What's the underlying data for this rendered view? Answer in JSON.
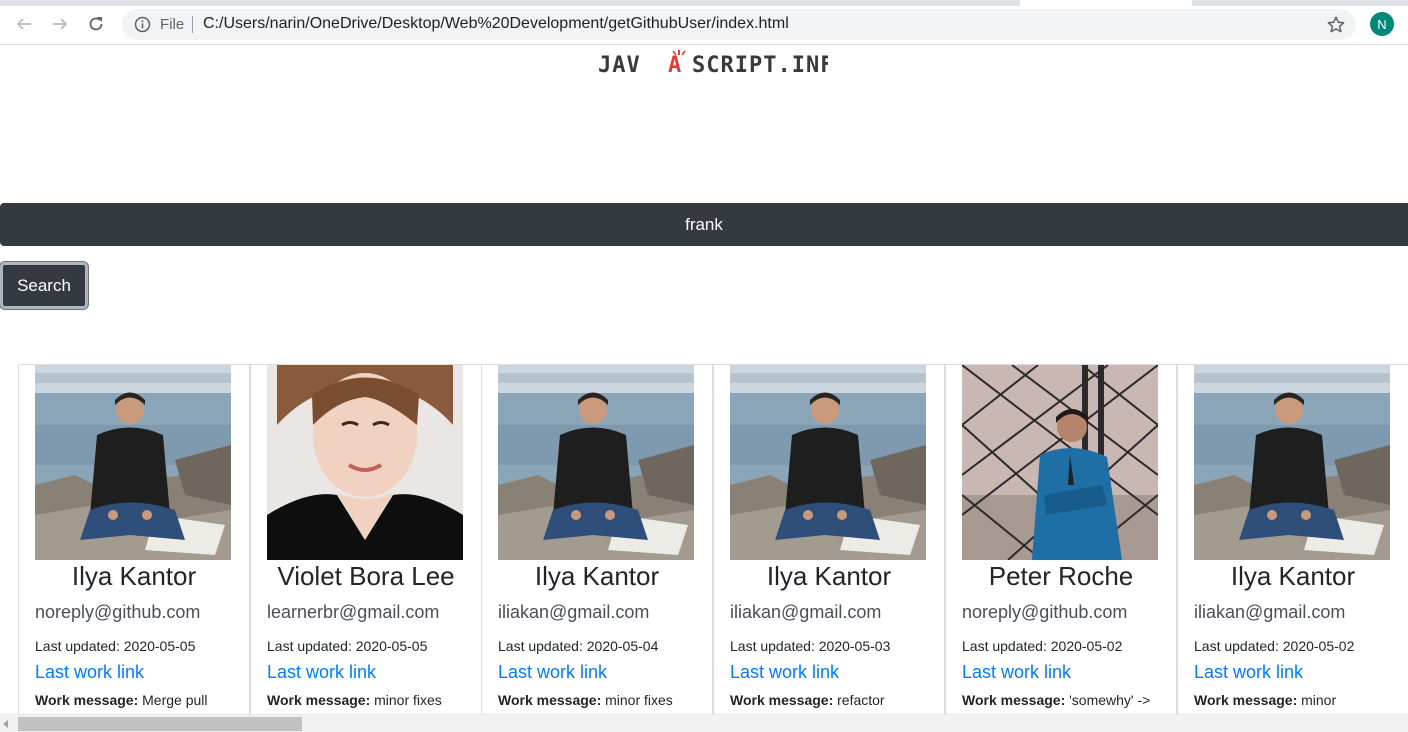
{
  "browser": {
    "file_label": "File",
    "url": "C:/Users/narin/OneDrive/Desktop/Web%20Development/getGithubUser/index.html",
    "profile_initial": "N",
    "colors": {
      "profile": "#00897b"
    }
  },
  "page": {
    "logo_text": "JAVASCRIPT.INFO",
    "search": {
      "value": "frank",
      "button_label": "Search"
    },
    "colors": {
      "dark": "#343a40",
      "link": "#007bff"
    }
  },
  "cards": [
    {
      "name": "Ilya Kantor",
      "email": "noreply@github.com",
      "updated_label": "Last updated:",
      "updated": "2020-05-05",
      "link": "Last work link",
      "msg_label": "Work message:",
      "msg": "Merge pull",
      "photo": "lake-photo"
    },
    {
      "name": "Violet Bora Lee",
      "email": "learnerbr@gmail.com",
      "updated_label": "Last updated:",
      "updated": "2020-05-05",
      "link": "Last work link",
      "msg_label": "Work message:",
      "msg": "minor fixes",
      "photo": "portrait-photo"
    },
    {
      "name": "Ilya Kantor",
      "email": "iliakan@gmail.com",
      "updated_label": "Last updated:",
      "updated": "2020-05-04",
      "link": "Last work link",
      "msg_label": "Work message:",
      "msg": "minor fixes",
      "photo": "lake-photo"
    },
    {
      "name": "Ilya Kantor",
      "email": "iliakan@gmail.com",
      "updated_label": "Last updated:",
      "updated": "2020-05-03",
      "link": "Last work link",
      "msg_label": "Work message:",
      "msg": "refactor",
      "photo": "lake-photo"
    },
    {
      "name": "Peter Roche",
      "email": "noreply@github.com",
      "updated_label": "Last updated:",
      "updated": "2020-05-02",
      "link": "Last work link",
      "msg_label": "Work message:",
      "msg": "'somewhy' ->",
      "photo": "tower-photo"
    },
    {
      "name": "Ilya Kantor",
      "email": "iliakan@gmail.com",
      "updated_label": "Last updated:",
      "updated": "2020-05-02",
      "link": "Last work link",
      "msg_label": "Work message:",
      "msg": "minor",
      "photo": "lake-photo"
    }
  ]
}
